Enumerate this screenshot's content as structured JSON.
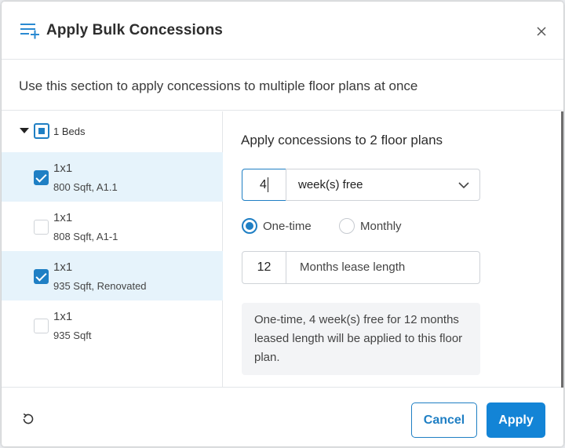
{
  "header": {
    "title": "Apply Bulk Concessions",
    "icon": "playlist-add-icon"
  },
  "subheader": {
    "text": "Use this section to apply concessions to multiple floor plans at once"
  },
  "floor_plans": {
    "group_label": "1 Beds",
    "group_state": "partial",
    "items": [
      {
        "name": "1x1",
        "details": "800 Sqft, A1.1",
        "selected": true
      },
      {
        "name": "1x1",
        "details": "808 Sqft, A1-1",
        "selected": false
      },
      {
        "name": "1x1",
        "details": "935 Sqft, Renovated",
        "selected": true
      },
      {
        "name": "1x1",
        "details": "935 Sqft",
        "selected": false
      }
    ]
  },
  "concession": {
    "title": "Apply concessions to 2 floor plans",
    "amount_value": "4",
    "type_selected": "week(s) free",
    "frequency_options": [
      {
        "label": "One-time",
        "selected": true
      },
      {
        "label": "Monthly",
        "selected": false
      }
    ],
    "lease_length_value": "12",
    "lease_length_label": "Months lease length",
    "summary": "One-time, 4 week(s) free for 12 months leased length will be applied to this floor plan."
  },
  "footer": {
    "cancel_label": "Cancel",
    "apply_label": "Apply"
  },
  "colors": {
    "accent": "#1f7fc4",
    "apply_button": "#1384d6",
    "selected_row": "#e6f3fb",
    "summary_bg": "#f3f4f6"
  }
}
